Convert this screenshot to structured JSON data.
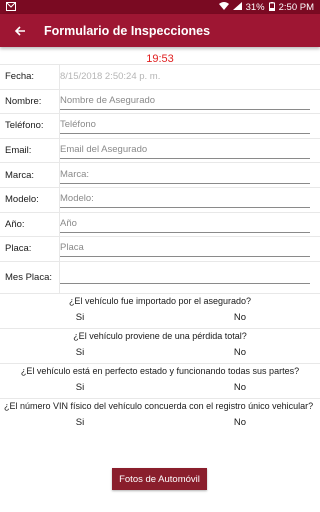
{
  "status_bar": {
    "battery": "31%",
    "time": "2:50 PM"
  },
  "app_bar": {
    "title": "Formulario de Inspecciones"
  },
  "timer": "19:53",
  "form": {
    "fields": [
      {
        "label": "Fecha:",
        "value": "8/15/2018 2:50:24 p. m.",
        "disabled": true
      },
      {
        "label": "Nombre:",
        "placeholder": "Nombre de Asegurado"
      },
      {
        "label": "Teléfono:",
        "placeholder": "Teléfono"
      },
      {
        "label": "Email:",
        "placeholder": "Email del Asegurado"
      },
      {
        "label": "Marca:",
        "placeholder": "Marca:"
      },
      {
        "label": "Modelo:",
        "placeholder": "Modelo:"
      },
      {
        "label": "Año:",
        "placeholder": "Año"
      },
      {
        "label": "Placa:",
        "placeholder": "Placa"
      },
      {
        "label": "Mes Placa:",
        "placeholder": ""
      }
    ],
    "questions": [
      {
        "text": "¿El vehículo fue importado por el asegurado?",
        "yes": "Si",
        "no": "No"
      },
      {
        "text": "¿El vehículo proviene de una pérdida total?",
        "yes": "Si",
        "no": "No"
      },
      {
        "text": "¿El vehículo está en perfecto estado y funcionando todas sus partes?",
        "yes": "Si",
        "no": "No"
      },
      {
        "text": "¿El número VIN físico del vehículo concuerda con el registro único vehicular?",
        "yes": "Si",
        "no": "No"
      }
    ]
  },
  "photos_button": "Fotos de Automóvil",
  "colors": {
    "app_bar": "#9e1633",
    "status_bar": "#7a0a22",
    "timer": "#e02020",
    "button": "#8a1e2c"
  }
}
